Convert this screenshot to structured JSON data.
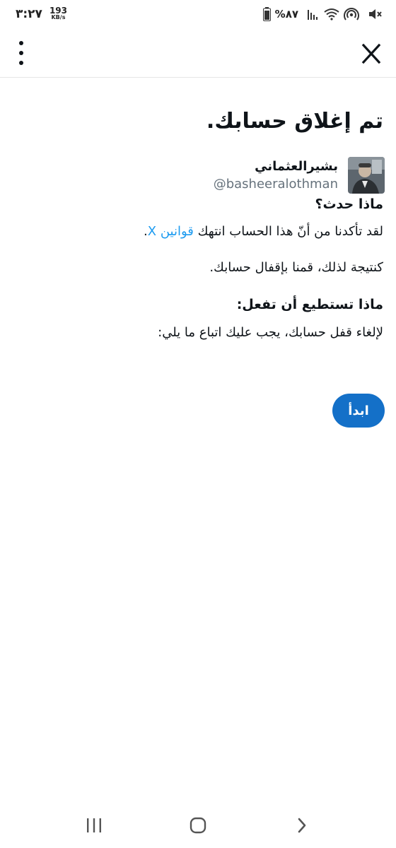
{
  "status_bar": {
    "time": "٣:٢٧",
    "net_speed_value": "193",
    "net_speed_unit": "KB/s",
    "battery_percent": "%٨٧",
    "icons": [
      "battery-icon",
      "signal-icon",
      "wifi-icon",
      "hotspot-icon",
      "mute-icon"
    ]
  },
  "app_bar": {
    "close_label": "X",
    "menu_icon": "more-vertical-icon"
  },
  "main": {
    "title": "تم إغلاق حسابك.",
    "account": {
      "name": "بشيرالعثماني",
      "handle": "@basheeralothman",
      "avatar_icon": "avatar"
    },
    "what_happened_heading": "ماذا حدث؟",
    "what_happened_text_before": "لقد تأكدنا من أنّ هذا الحساب انتهك ",
    "rules_link": "قوانين X",
    "what_happened_text_after": ".",
    "consequence_text": "كنتيجة لذلك، قمنا بإقفال حسابك.",
    "what_to_do_heading": "ماذا تستطيع أن تفعل:",
    "what_to_do_text": "لإلغاء قفل حسابك، يجب عليك اتباع ما يلي:",
    "start_button": "ابدأ"
  },
  "nav_bar": {
    "icons": [
      "recents-icon",
      "home-icon",
      "back-icon"
    ]
  },
  "colors": {
    "link": "#1d9bf0",
    "button": "#1470c8",
    "text": "#0f1419",
    "muted": "#66727c"
  }
}
